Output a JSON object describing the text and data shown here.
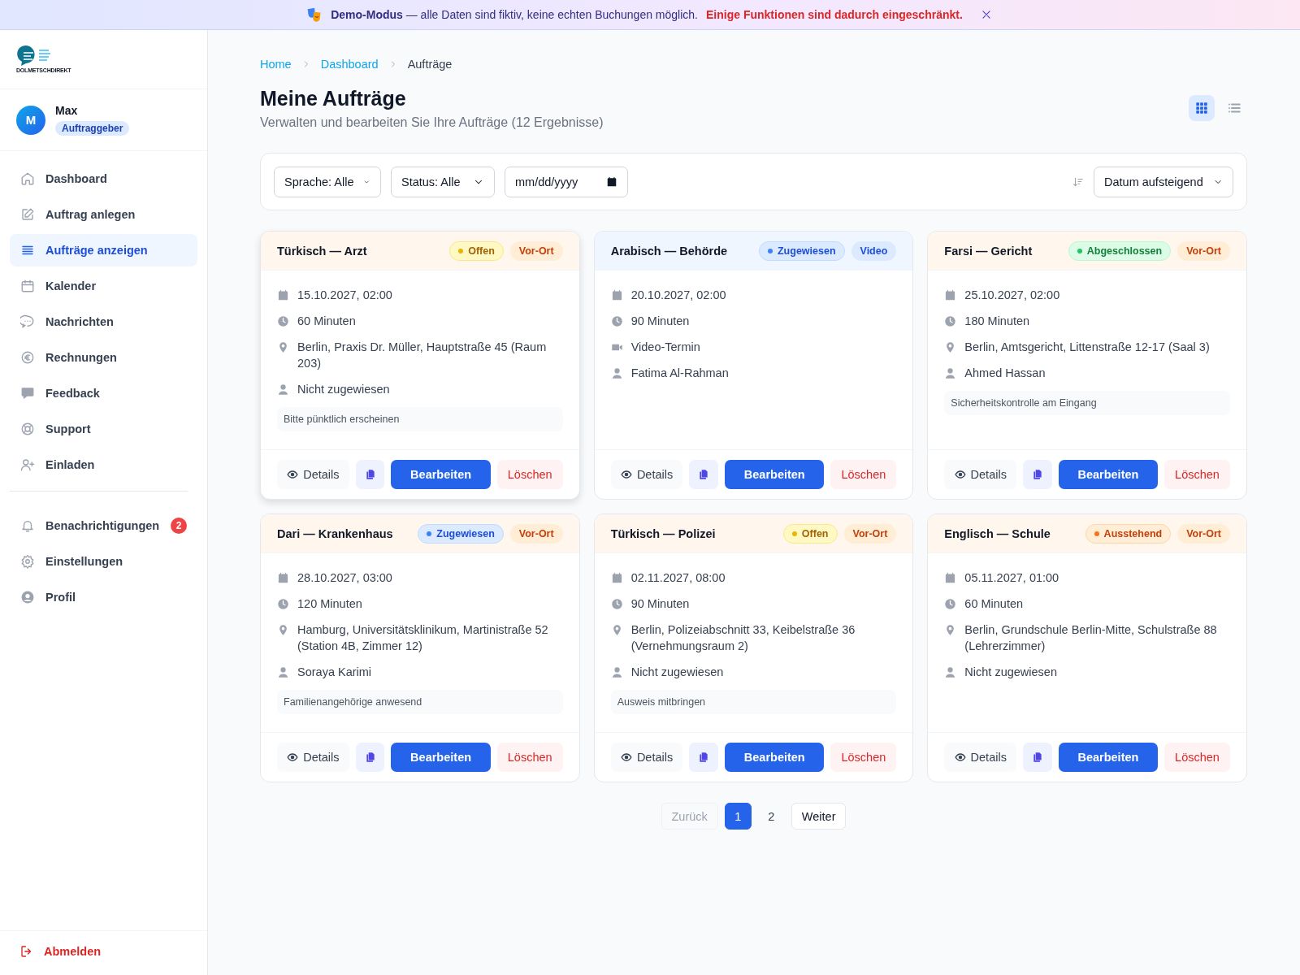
{
  "banner": {
    "text": "**Demo-Modus** — alle Daten sind fiktiv, keine echten Buchungen möglich.",
    "warning": "Einige Funktionen sind dadurch eingeschränkt."
  },
  "sidebar": {
    "logo_text": "DOLMETSCHDIREKT",
    "user": {
      "initial": "M",
      "name": "Max",
      "role": "Auftraggeber"
    },
    "nav": [
      {
        "label": "Dashboard",
        "selected": false
      },
      {
        "label": "Auftrag anlegen",
        "selected": false
      },
      {
        "label": "Aufträge anzeigen",
        "selected": true
      },
      {
        "label": "Kalender",
        "selected": false
      },
      {
        "label": "Nachrichten",
        "selected": false
      },
      {
        "label": "Rechnungen",
        "selected": false
      },
      {
        "label": "Feedback",
        "selected": false
      },
      {
        "label": "Support",
        "selected": false
      },
      {
        "label": "Einladen",
        "selected": false
      }
    ],
    "secondary": [
      {
        "label": "Benachrichtigungen",
        "selected": false,
        "badge": "2"
      },
      {
        "label": "Einstellungen",
        "selected": false
      },
      {
        "label": "Profil",
        "selected": false
      }
    ],
    "logout": "Abmelden"
  },
  "breadcrumb": [
    {
      "label": "Home",
      "link": true
    },
    {
      "label": "Dashboard",
      "link": true
    },
    {
      "label": "Aufträge",
      "link": false
    }
  ],
  "page": {
    "title": "Meine Aufträge",
    "subtitle": "Verwalten und bearbeiten Sie Ihre Aufträge (12 Ergebnisse)"
  },
  "view_toggle": [
    {
      "kind": "grid",
      "selected": true
    },
    {
      "kind": "list",
      "selected": false
    }
  ],
  "filters": {
    "language": "Sprache: Alle",
    "status": "Status: Alle",
    "date": "mm/dd/yyyy",
    "sort": "Datum aufsteigend"
  },
  "cards": [
    {
      "title": "Türkisch — Arzt",
      "hovered": true,
      "status": {
        "label": "Offen",
        "kind": "offen"
      },
      "mode": {
        "label": "Vor-Ort",
        "kind": "onsite"
      },
      "details": [
        {
          "kind": "date",
          "text": "15.10.2027, 02:00"
        },
        {
          "kind": "duration",
          "text": "60 Minuten"
        },
        {
          "kind": "location",
          "text": "Berlin, Praxis Dr. Müller, Hauptstraße 45 (Raum 203)"
        },
        {
          "kind": "person",
          "text": "Nicht zugewiesen"
        }
      ],
      "note": "Bitte pünktlich erscheinen",
      "actions": {
        "details": "Details",
        "edit": "Bearbeiten",
        "delete": "Löschen"
      }
    },
    {
      "title": "Arabisch — Behörde",
      "hovered": false,
      "status": {
        "label": "Zugewiesen",
        "kind": "zugewiesen"
      },
      "mode": {
        "label": "Video",
        "kind": "video"
      },
      "details": [
        {
          "kind": "date",
          "text": "20.10.2027, 02:00"
        },
        {
          "kind": "duration",
          "text": "90 Minuten"
        },
        {
          "kind": "video",
          "text": "Video-Termin"
        },
        {
          "kind": "person",
          "text": "Fatima Al-Rahman"
        }
      ],
      "actions": {
        "details": "Details",
        "edit": "Bearbeiten",
        "delete": "Löschen"
      }
    },
    {
      "title": "Farsi — Gericht",
      "hovered": false,
      "status": {
        "label": "Abgeschlossen",
        "kind": "abgeschlossen"
      },
      "mode": {
        "label": "Vor-Ort",
        "kind": "onsite"
      },
      "details": [
        {
          "kind": "date",
          "text": "25.10.2027, 02:00"
        },
        {
          "kind": "duration",
          "text": "180 Minuten"
        },
        {
          "kind": "location",
          "text": "Berlin, Amtsgericht, Littenstraße 12-17 (Saal 3)"
        },
        {
          "kind": "person",
          "text": "Ahmed Hassan"
        }
      ],
      "note": "Sicherheitskontrolle am Eingang",
      "actions": {
        "details": "Details",
        "edit": "Bearbeiten",
        "delete": "Löschen"
      }
    },
    {
      "title": "Dari — Krankenhaus",
      "hovered": false,
      "status": {
        "label": "Zugewiesen",
        "kind": "zugewiesen"
      },
      "mode": {
        "label": "Vor-Ort",
        "kind": "onsite"
      },
      "details": [
        {
          "kind": "date",
          "text": "28.10.2027, 03:00"
        },
        {
          "kind": "duration",
          "text": "120 Minuten"
        },
        {
          "kind": "location",
          "text": "Hamburg, Universitätsklinikum, Martinistraße 52 (Station 4B, Zimmer 12)"
        },
        {
          "kind": "person",
          "text": "Soraya Karimi"
        }
      ],
      "note": "Familienangehörige anwesend",
      "actions": {
        "details": "Details",
        "edit": "Bearbeiten",
        "delete": "Löschen"
      }
    },
    {
      "title": "Türkisch — Polizei",
      "hovered": false,
      "status": {
        "label": "Offen",
        "kind": "offen"
      },
      "mode": {
        "label": "Vor-Ort",
        "kind": "onsite"
      },
      "details": [
        {
          "kind": "date",
          "text": "02.11.2027, 08:00"
        },
        {
          "kind": "duration",
          "text": "90 Minuten"
        },
        {
          "kind": "location",
          "text": "Berlin, Polizeiabschnitt 33, Keibelstraße 36 (Vernehmungsraum 2)"
        },
        {
          "kind": "person",
          "text": "Nicht zugewiesen"
        }
      ],
      "note": "Ausweis mitbringen",
      "actions": {
        "details": "Details",
        "edit": "Bearbeiten",
        "delete": "Löschen"
      }
    },
    {
      "title": "Englisch — Schule",
      "hovered": false,
      "status": {
        "label": "Ausstehend",
        "kind": "ausstehend"
      },
      "mode": {
        "label": "Vor-Ort",
        "kind": "onsite"
      },
      "details": [
        {
          "kind": "date",
          "text": "05.11.2027, 01:00"
        },
        {
          "kind": "duration",
          "text": "60 Minuten"
        },
        {
          "kind": "location",
          "text": "Berlin, Grundschule Berlin-Mitte, Schulstraße 88 (Lehrerzimmer)"
        },
        {
          "kind": "person",
          "text": "Nicht zugewiesen"
        }
      ],
      "actions": {
        "details": "Details",
        "edit": "Bearbeiten",
        "delete": "Löschen"
      }
    }
  ],
  "pagination": [
    {
      "label": "Zurück",
      "kind": "prev",
      "disabled": true,
      "selected": false
    },
    {
      "label": "1",
      "kind": "page",
      "disabled": false,
      "selected": true
    },
    {
      "label": "2",
      "kind": "page",
      "disabled": false,
      "selected": false
    },
    {
      "label": "Weiter",
      "kind": "next",
      "disabled": false,
      "selected": false
    }
  ]
}
